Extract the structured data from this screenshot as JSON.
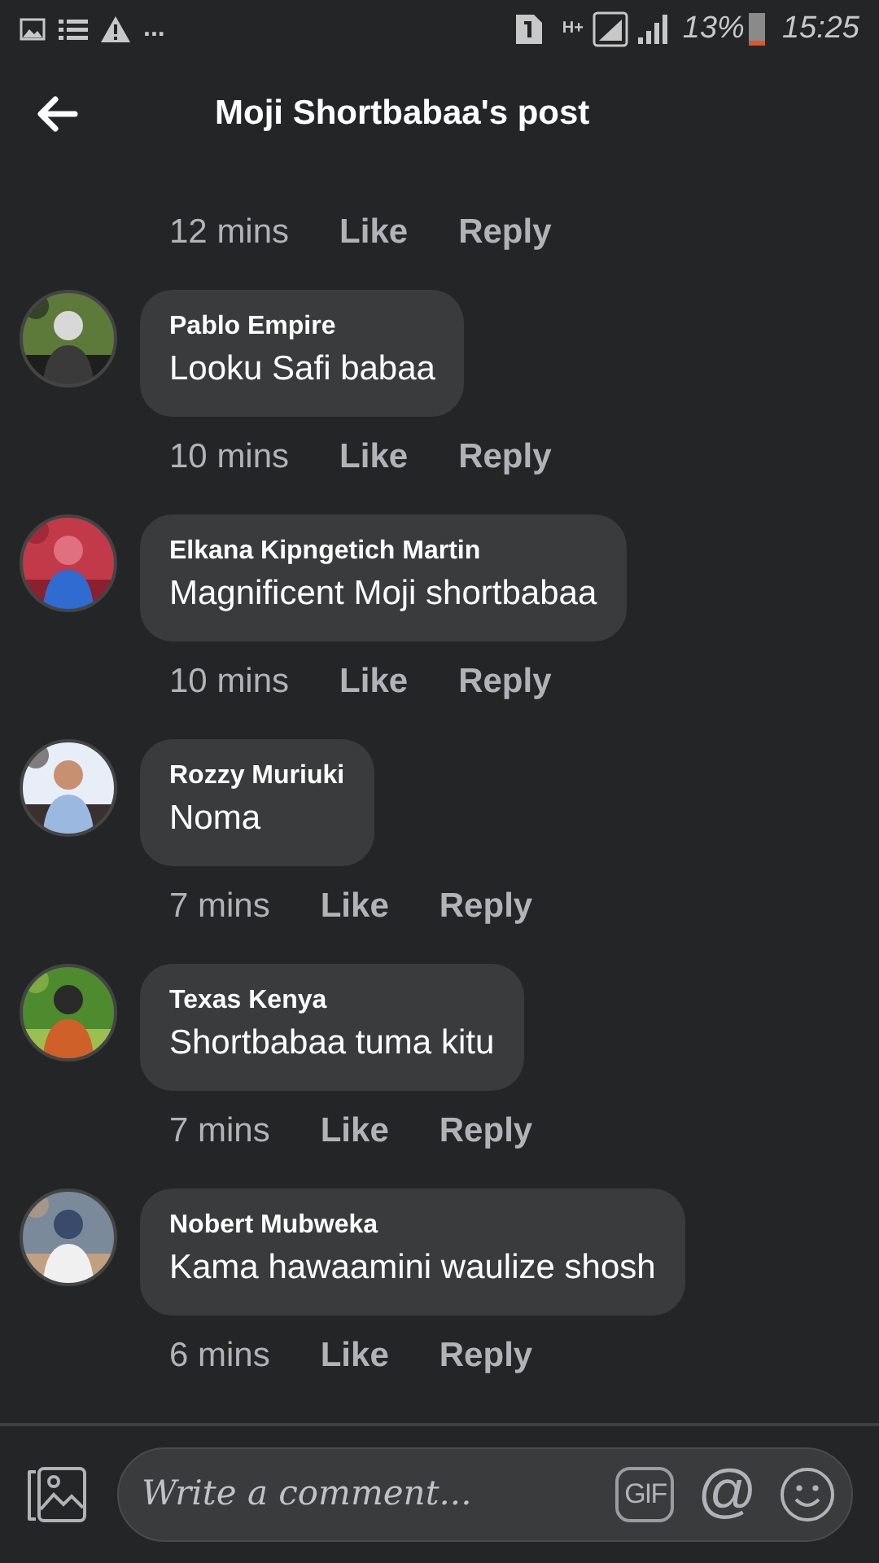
{
  "status_bar": {
    "overflow": "...",
    "network": "H+",
    "battery": "13%",
    "time": "15:25"
  },
  "header": {
    "title": "Moji Shortbabaa's post"
  },
  "first_actions": {
    "time": "12 mins",
    "like": "Like",
    "reply": "Reply"
  },
  "comments": [
    {
      "author": "Pablo Empire",
      "text": "Looku Safi babaa",
      "time": "10 mins",
      "like": "Like",
      "reply": "Reply"
    },
    {
      "author": "Elkana Kipngetich Martin",
      "text": "Magnificent Moji shortbabaa",
      "time": "10 mins",
      "like": "Like",
      "reply": "Reply"
    },
    {
      "author": "Rozzy Muriuki",
      "text": "Noma",
      "time": "7 mins",
      "like": "Like",
      "reply": "Reply"
    },
    {
      "author": "Texas Kenya",
      "text": "Shortbabaa tuma kitu",
      "time": "7 mins",
      "like": "Like",
      "reply": "Reply"
    },
    {
      "author": "Nobert Mubweka",
      "text": "Kama hawaamini waulize shosh",
      "time": "6 mins",
      "like": "Like",
      "reply": "Reply"
    }
  ],
  "composer": {
    "placeholder": "Write a comment...",
    "gif": "GIF",
    "mention": "@"
  }
}
